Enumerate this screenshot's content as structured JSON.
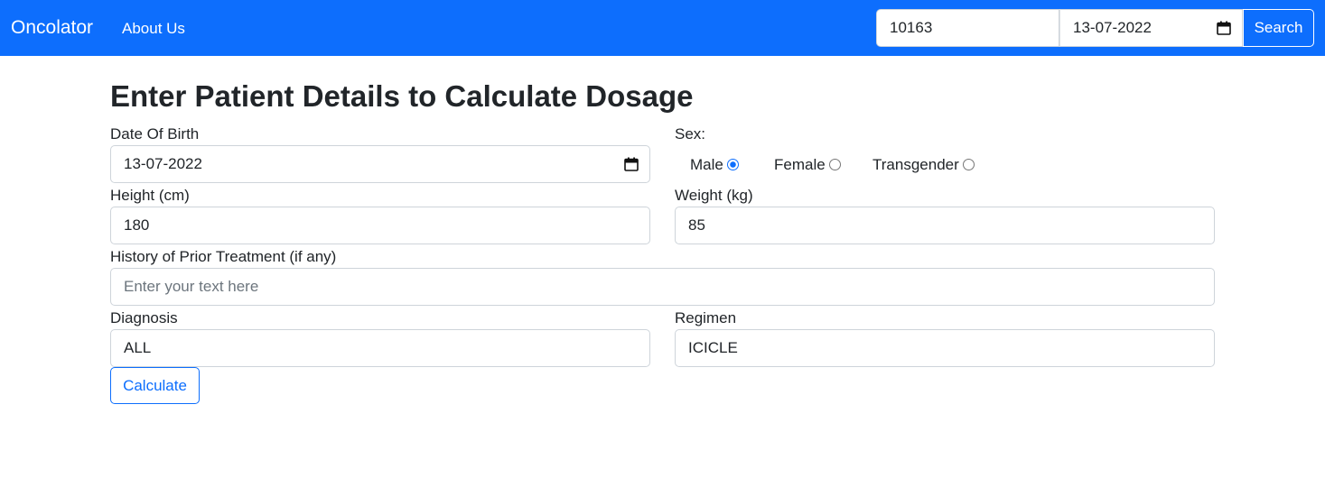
{
  "navbar": {
    "brand": "Oncolator",
    "about_link": "About Us",
    "search_value": "10163",
    "date_value": "13-07-2022",
    "search_button": "Search"
  },
  "heading": "Enter Patient Details to Calculate Dosage",
  "form": {
    "dob_label": "Date Of Birth",
    "dob_value": "13-07-2022",
    "sex_label": "Sex:",
    "sex_options": [
      "Male",
      "Female",
      "Transgender"
    ],
    "sex_selected": "Male",
    "height_label": "Height (cm)",
    "height_value": "180",
    "weight_label": "Weight (kg)",
    "weight_value": "85",
    "history_label": "History of Prior Treatment (if any)",
    "history_placeholder": "Enter your text here",
    "diagnosis_label": "Diagnosis",
    "diagnosis_value": "ALL",
    "regimen_label": "Regimen",
    "regimen_value": "ICICLE",
    "calculate_button": "Calculate"
  },
  "colors": {
    "primary": "#0d6efd",
    "text": "#212529",
    "border": "#ced4da",
    "placeholder": "#6c757d"
  },
  "icons": {
    "calendar": "calendar-icon",
    "radio": "radio-icon"
  }
}
